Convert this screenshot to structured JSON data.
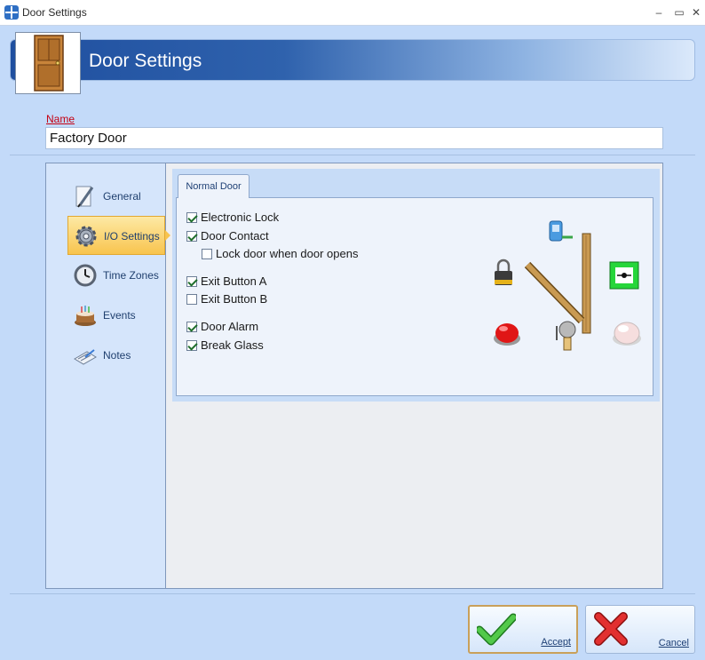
{
  "window": {
    "title": "Door Settings",
    "minimize_label": "–",
    "maximize_label": "▭",
    "close_label": "✕"
  },
  "header": {
    "title": "Door Settings",
    "icon": "door-icon"
  },
  "name_field": {
    "label": "Name",
    "value": "Factory Door"
  },
  "sidebar": {
    "items": [
      {
        "label": "General",
        "icon": "pencil-document-icon",
        "active": false
      },
      {
        "label": "I/O Settings",
        "icon": "gear-icon",
        "active": true
      },
      {
        "label": "Time Zones",
        "icon": "clock-icon",
        "active": false
      },
      {
        "label": "Events",
        "icon": "cake-icon",
        "active": false
      },
      {
        "label": "Notes",
        "icon": "notepad-icon",
        "active": false
      }
    ]
  },
  "tab": {
    "label": "Normal Door"
  },
  "options": [
    {
      "label": "Electronic Lock",
      "checked": true
    },
    {
      "label": "Door Contact",
      "checked": true
    },
    {
      "label": "Lock door when door opens",
      "checked": false
    },
    {
      "label": "Exit Button A",
      "checked": true
    },
    {
      "label": "Exit Button B",
      "checked": false
    },
    {
      "label": "Door Alarm",
      "checked": true
    },
    {
      "label": "Break Glass",
      "checked": true
    }
  ],
  "diagram": {
    "icons": [
      "door-contact-sensor-icon",
      "padlock-icon",
      "door-panel-icon",
      "exit-button-green-icon",
      "red-alarm-button-icon",
      "alarm-bell-icon",
      "break-glass-button-icon"
    ]
  },
  "actions": {
    "accept_label": "Accept",
    "cancel_label": "Cancel"
  },
  "colors": {
    "background": "#c3daf9",
    "banner_start": "#1f4f9f",
    "active_nav": "#f8c44e",
    "name_label": "#c40012"
  }
}
